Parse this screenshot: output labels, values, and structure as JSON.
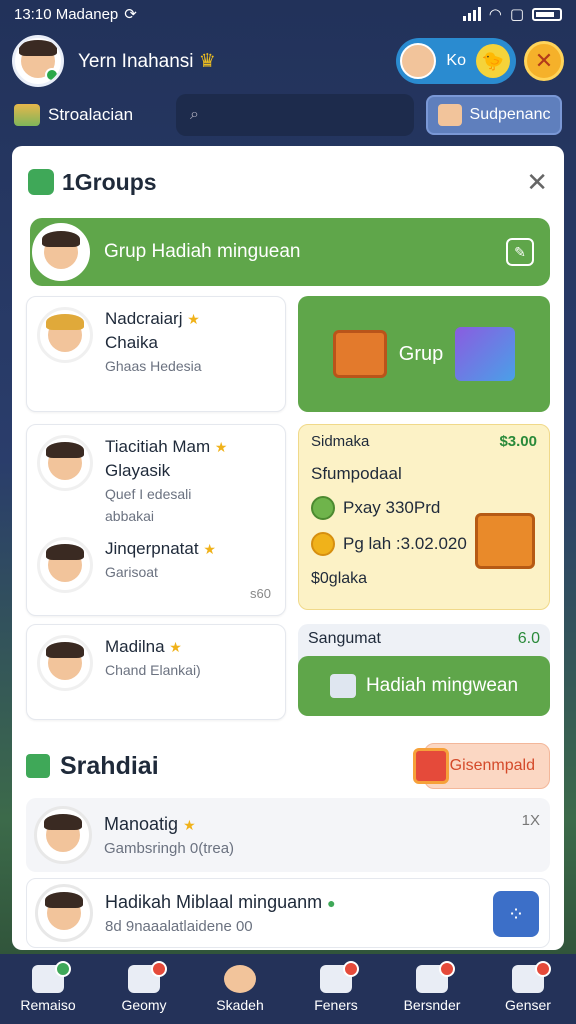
{
  "status": {
    "time": "13:10 Madanep"
  },
  "top": {
    "user_name": "Yern Inahansi",
    "level": "Ko"
  },
  "subbar": {
    "tab": "Stroalacian",
    "search_placeholder": "",
    "side_button": "Sudpenanc"
  },
  "panel": {
    "title": "1Groups"
  },
  "banner": {
    "text": "Grup Hadiah minguean"
  },
  "members": [
    {
      "name": "Nadcraiarj",
      "name2": "Chaika",
      "sub": "Ghaas Hedesia"
    },
    {
      "name": "Tiacitiah Mam",
      "name2": "Glayasik",
      "sub": "Quef I edesali",
      "sub2": "abbakai"
    },
    {
      "name": "Jinqerpnatat",
      "sub": "Garisoat",
      "side": "s60"
    },
    {
      "name": "Madilna",
      "sub": "Chand Elankai)"
    }
  ],
  "gift_card": {
    "label": "Grup"
  },
  "offer": {
    "title": "Sidmaka",
    "price": "$3.00",
    "label": "Sfumpodaal",
    "line1": "Pxay 330Prd",
    "line2": "Pg lah :3.02.020",
    "footer": "$0glaka"
  },
  "reward": {
    "title": "Sangumat",
    "value": "6.0",
    "button": "Hadiah mingwean"
  },
  "section": {
    "title": "Srahdiai",
    "button": "Gisenmpald"
  },
  "list": [
    {
      "name": "Manoatig",
      "sub": "Gambsringh 0(trea)",
      "side": "1X"
    },
    {
      "name": "Hadikah Miblaal minguanm",
      "sub": "8d 9naaalatlaidene 00"
    }
  ],
  "nav": [
    {
      "label": "Remaiso"
    },
    {
      "label": "Geomy"
    },
    {
      "label": "Skadeh"
    },
    {
      "label": "Feners"
    },
    {
      "label": "Bersnder"
    },
    {
      "label": "Genser"
    }
  ]
}
